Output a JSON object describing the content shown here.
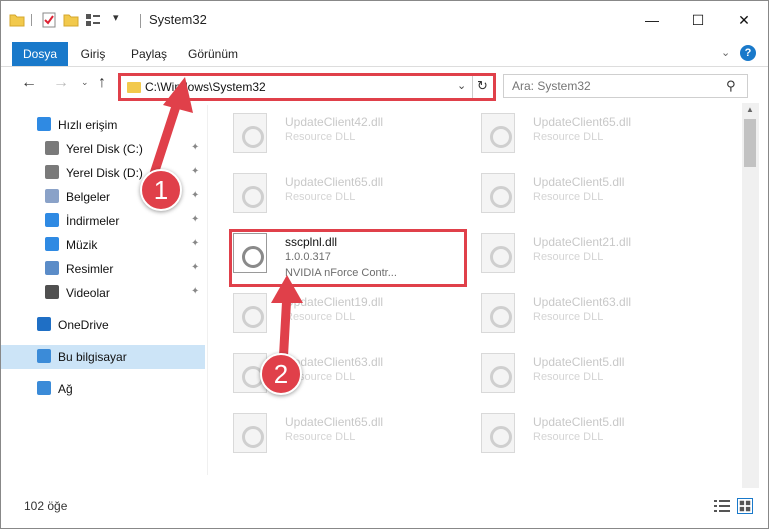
{
  "window": {
    "title": "System32",
    "minimize_glyph": "—",
    "maximize_glyph": "☐",
    "close_glyph": "✕"
  },
  "quick_access": {
    "icons": [
      "folder-icon",
      "properties-icon",
      "new-folder-icon",
      "customize-icon"
    ],
    "chevron": "▾"
  },
  "ribbon": {
    "tabs": [
      {
        "label": "Dosya",
        "active": true
      },
      {
        "label": "Giriş"
      },
      {
        "label": "Paylaş"
      },
      {
        "label": "Görünüm"
      }
    ],
    "expand_glyph": "⌄",
    "help_glyph": "?"
  },
  "nav": {
    "back_glyph": "←",
    "forward_glyph": "→",
    "recent_glyph": "⌄",
    "up_glyph": "↑",
    "address": "C:\\Windows\\System32",
    "address_dropdown": "⌄",
    "refresh_glyph": "↻",
    "search_placeholder": "Ara: System32",
    "search_glyph": "⚲"
  },
  "sidebar": {
    "items": [
      {
        "label": "Hızlı erişim",
        "icon": "star-icon",
        "color": "#2f8ae3",
        "top": true
      },
      {
        "label": "Yerel Disk (C:)",
        "icon": "drive-icon",
        "color": "#7a7a7a",
        "pinned": true
      },
      {
        "label": "Yerel Disk (D:)",
        "icon": "drive-icon",
        "color": "#7a7a7a",
        "pinned": true
      },
      {
        "label": "Belgeler",
        "icon": "documents-icon",
        "color": "#8aa2c8",
        "pinned": true
      },
      {
        "label": "İndirmeler",
        "icon": "downloads-icon",
        "color": "#2f8ae3",
        "pinned": true
      },
      {
        "label": "Müzik",
        "icon": "music-icon",
        "color": "#2f8ae3",
        "pinned": true
      },
      {
        "label": "Resimler",
        "icon": "pictures-icon",
        "color": "#5b8cc8",
        "pinned": true
      },
      {
        "label": "Videolar",
        "icon": "videos-icon",
        "color": "#505050",
        "pinned": true
      },
      {
        "label": "OneDrive",
        "icon": "onedrive-icon",
        "color": "#1f6fc5",
        "top": true
      },
      {
        "label": "Bu bilgisayar",
        "icon": "computer-icon",
        "color": "#3b8bd8",
        "top": true,
        "selected": true
      },
      {
        "label": "Ağ",
        "icon": "network-icon",
        "color": "#3b8bd8",
        "top": true
      }
    ],
    "pin_glyph": "📌"
  },
  "files": [
    {
      "name": "UpdateClient42.dll",
      "type": "Resource DLL"
    },
    {
      "name": "UpdateClient65.dll",
      "type": "Resource DLL"
    },
    {
      "name": "UpdateClient65.dll",
      "type": "Resource DLL"
    },
    {
      "name": "UpdateClient5.dll",
      "type": "Resource DLL"
    },
    {
      "name": "sscplnl.dll",
      "version": "1.0.0.317",
      "type": "NVIDIA nForce Contr...",
      "highlighted": true
    },
    {
      "name": "UpdateClient21.dll",
      "type": "Resource DLL"
    },
    {
      "name": "UpdateClient19.dll",
      "type": "Resource DLL"
    },
    {
      "name": "UpdateClient63.dll",
      "type": "Resource DLL"
    },
    {
      "name": "UpdateClient63.dll",
      "type": "Resource DLL"
    },
    {
      "name": "UpdateClient5.dll",
      "type": "Resource DLL"
    },
    {
      "name": "UpdateClient65.dll",
      "type": "Resource DLL"
    },
    {
      "name": "UpdateClient5.dll",
      "type": "Resource DLL"
    }
  ],
  "annotations": {
    "step1": "1",
    "step2": "2",
    "color": "#e0404a"
  },
  "status": {
    "item_count": "102 öğe"
  }
}
